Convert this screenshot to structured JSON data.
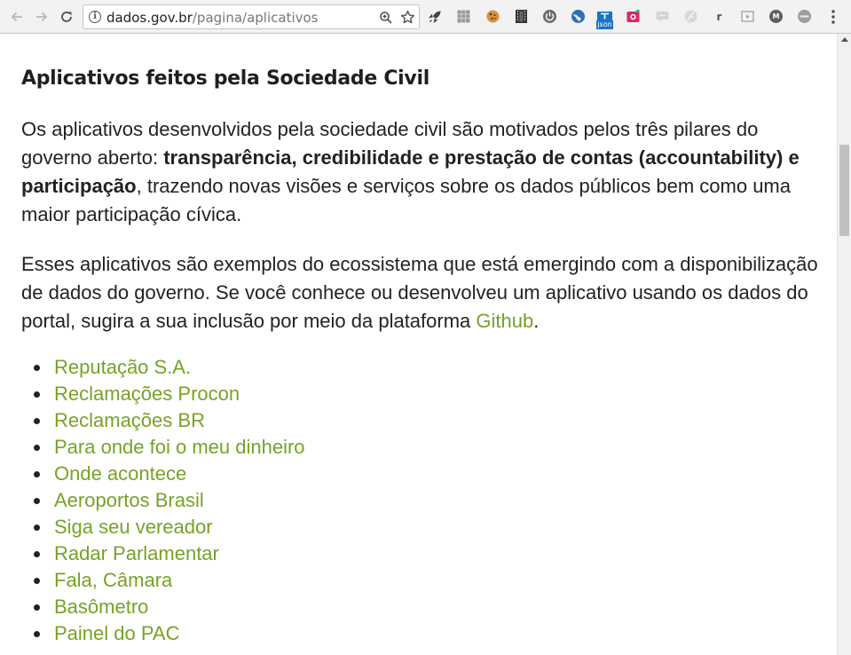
{
  "browser": {
    "url_host": "dados.gov.br",
    "url_path": "/pagina/aplicativos",
    "extensions": [
      {
        "name": "rocket-icon"
      },
      {
        "name": "grid-icon"
      },
      {
        "name": "cookie-icon"
      },
      {
        "name": "film-icon"
      },
      {
        "name": "power-icon"
      },
      {
        "name": "globe-icon"
      },
      {
        "name": "json-icon",
        "label": "json"
      },
      {
        "name": "camera-icon"
      },
      {
        "name": "chat-icon"
      },
      {
        "name": "feather-icon"
      },
      {
        "name": "r-icon",
        "label": "r"
      },
      {
        "name": "media-icon"
      },
      {
        "name": "m-icon",
        "label": "M"
      },
      {
        "name": "badge-icon"
      }
    ]
  },
  "page": {
    "heading": "Aplicativos feitos pela Sociedade Civil",
    "p1": {
      "before": "Os aplicativos desenvolvidos pela sociedade civil são motivados pelos três pilares do governo aberto: ",
      "bold": "transparência, credibilidade e prestação de contas (accountability) e participação",
      "after": ", trazendo novas visões e serviços sobre os dados públicos bem como uma maior participação cívica."
    },
    "p2": {
      "before": "Esses aplicativos são exemplos do ecossistema que está emergindo com a disponibilização de dados do governo. Se você conhece ou desenvolveu um aplicativo usando os dados do portal, sugira a sua inclusão por meio da plataforma ",
      "link": "Github",
      "after": "."
    },
    "apps": [
      "Reputação S.A.",
      "Reclamações Procon",
      "Reclamações BR",
      "Para onde foi o meu dinheiro",
      "Onde acontece",
      "Aeroportos Brasil",
      "Siga seu vereador",
      "Radar Parlamentar",
      "Fala, Câmara",
      "Basômetro",
      "Painel do PAC"
    ]
  },
  "colors": {
    "link": "#77a227",
    "text": "#222222",
    "heading": "#1f1f1f"
  }
}
